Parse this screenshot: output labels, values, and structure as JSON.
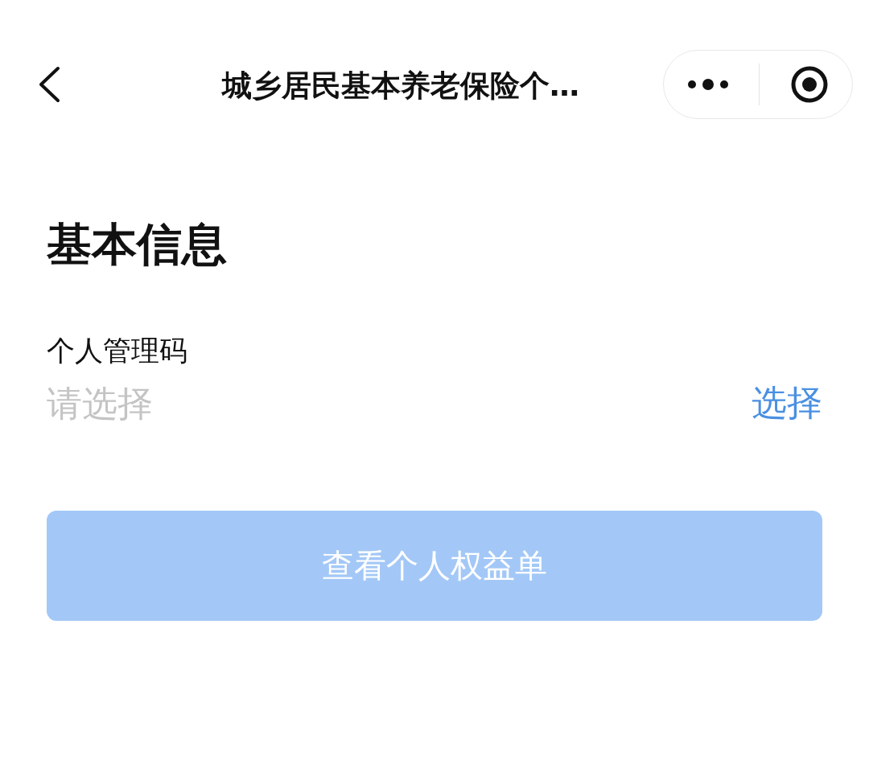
{
  "nav_bar": {
    "title": "城乡居民基本养老保险个…"
  },
  "section": {
    "heading": "基本信息"
  },
  "field": {
    "label": "个人管理码",
    "placeholder": "请选择",
    "action": "选择"
  },
  "button": {
    "label": "查看个人权益单",
    "disabled": true
  }
}
